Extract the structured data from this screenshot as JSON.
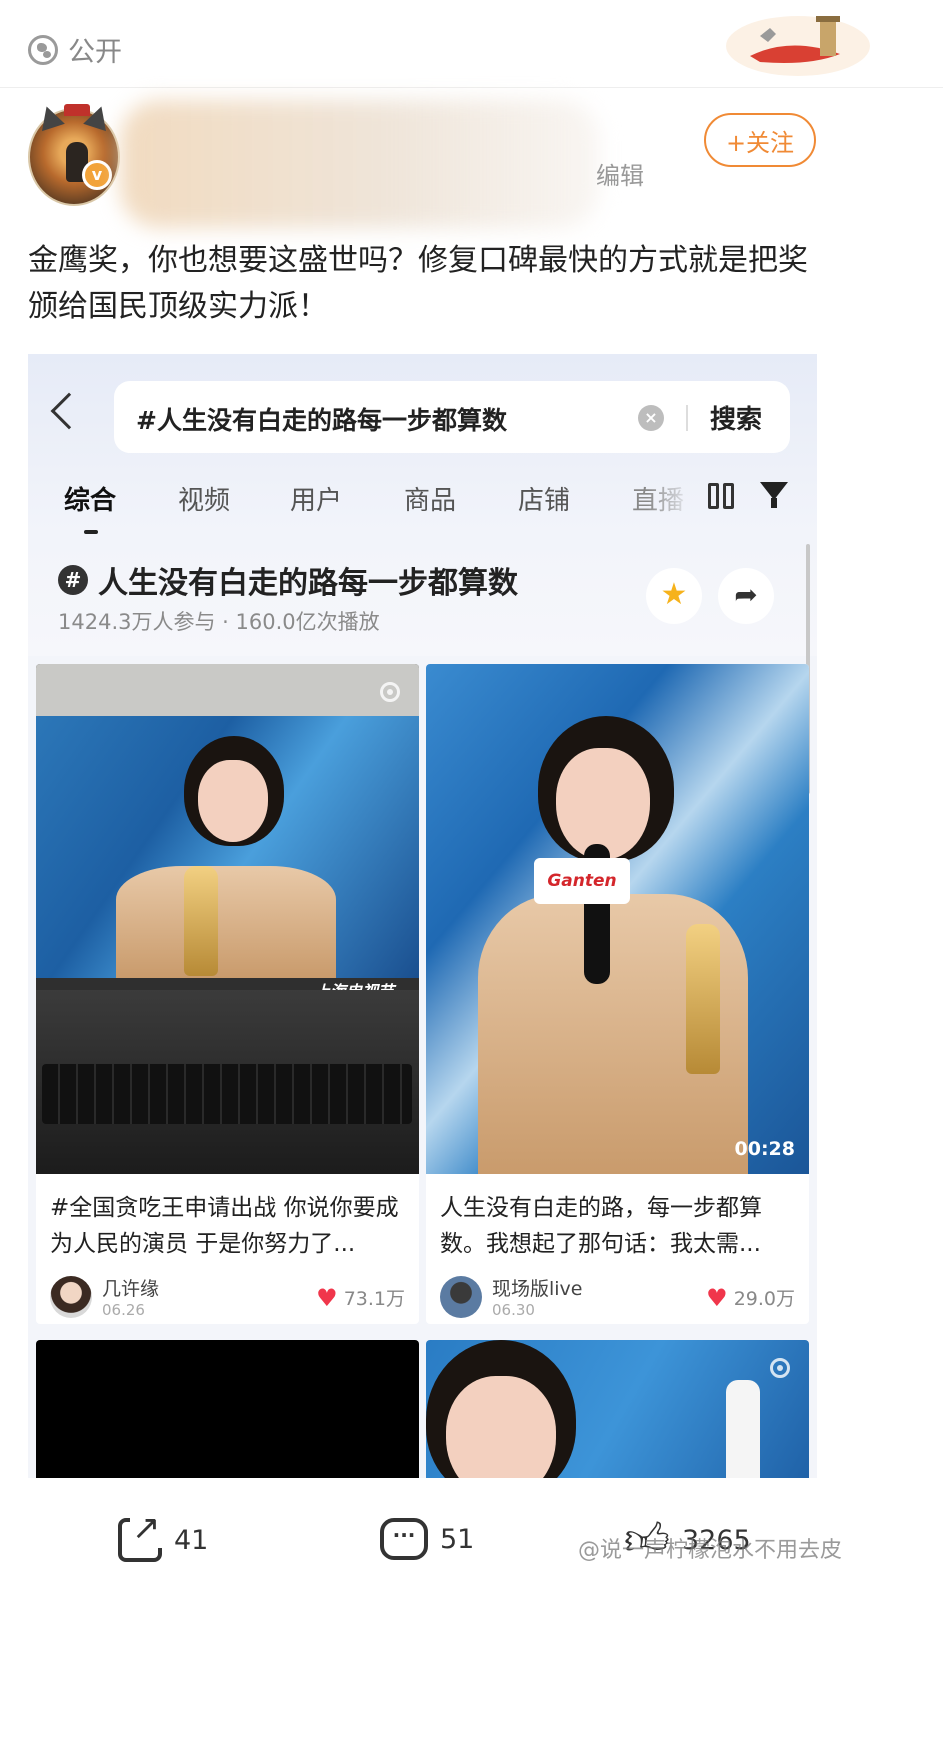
{
  "header": {
    "visibility_label": "公开"
  },
  "author": {
    "edited_label": "编辑",
    "follow_label": "+关注",
    "verified_badge": "v"
  },
  "post": {
    "text": "金鹰奖，你也想要这盛世吗？修复口碑最快的方式就是把奖颁给国民顶级实力派！"
  },
  "embed": {
    "search": {
      "query": "#人生没有白走的路每一步都算数",
      "button": "搜索"
    },
    "tabs": [
      "综合",
      "视频",
      "用户",
      "商品",
      "店铺",
      "直播"
    ],
    "topic": {
      "title": "人生没有白走的路每一步都算数",
      "stats": "1424.3万人参与 · 160.0亿次播放"
    },
    "cards": [
      {
        "title": "#全国贪吃王申请出战  你说你要成为人民的演员 于是你努力了...",
        "user": "几许缘",
        "date": "06.26",
        "likes": "73.1万",
        "duration": ""
      },
      {
        "title": "人生没有白走的路，每一步都算数。我想起了那句话：我太需...",
        "user": "现场版live",
        "date": "06.30",
        "likes": "29.0万",
        "duration": "00:28"
      }
    ],
    "mic_brand": "Ganten",
    "tv_logo": "上海电视节"
  },
  "actions": {
    "shares": "41",
    "comments": "51",
    "likes": "3265"
  },
  "watermark": "@说一声柠檬泡水不用去皮",
  "colors": {
    "accent_orange": "#f08a35",
    "like_red": "#f0364b",
    "star_yellow": "#f6b21b"
  }
}
